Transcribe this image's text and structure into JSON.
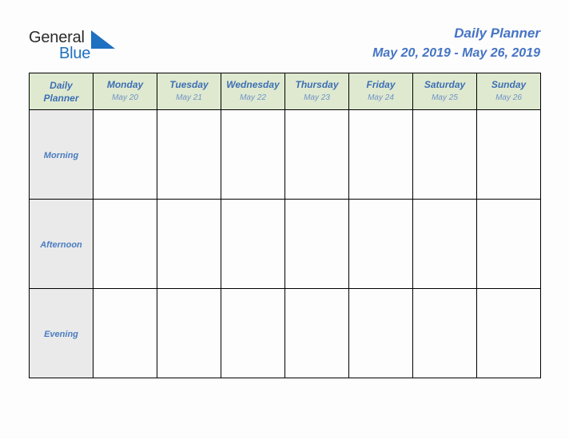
{
  "brand": {
    "name_part1": "General",
    "name_part2": "Blue",
    "mark_icon": "triangle-flag-icon"
  },
  "header": {
    "title": "Daily Planner",
    "date_range": "May 20, 2019 - May 26, 2019"
  },
  "colors": {
    "accent_blue": "#4574c4",
    "day_name_blue": "#3d6fb4",
    "date_blue": "#6f93c8",
    "header_green": "#dfe9cf",
    "label_gray": "#eaeaea",
    "brand_blue": "#1e70c1",
    "brand_dark": "#2b2b2b",
    "border": "#000000"
  },
  "table": {
    "corner": {
      "line1": "Daily",
      "line2": "Planner"
    },
    "columns": [
      {
        "day": "Monday",
        "date": "May 20"
      },
      {
        "day": "Tuesday",
        "date": "May 21"
      },
      {
        "day": "Wednesday",
        "date": "May 22"
      },
      {
        "day": "Thursday",
        "date": "May 23"
      },
      {
        "day": "Friday",
        "date": "May 24"
      },
      {
        "day": "Saturday",
        "date": "May 25"
      },
      {
        "day": "Sunday",
        "date": "May 26"
      }
    ],
    "rows": [
      {
        "label": "Morning",
        "cells": [
          "",
          "",
          "",
          "",
          "",
          "",
          ""
        ]
      },
      {
        "label": "Afternoon",
        "cells": [
          "",
          "",
          "",
          "",
          "",
          "",
          ""
        ]
      },
      {
        "label": "Evening",
        "cells": [
          "",
          "",
          "",
          "",
          "",
          "",
          ""
        ]
      }
    ]
  }
}
